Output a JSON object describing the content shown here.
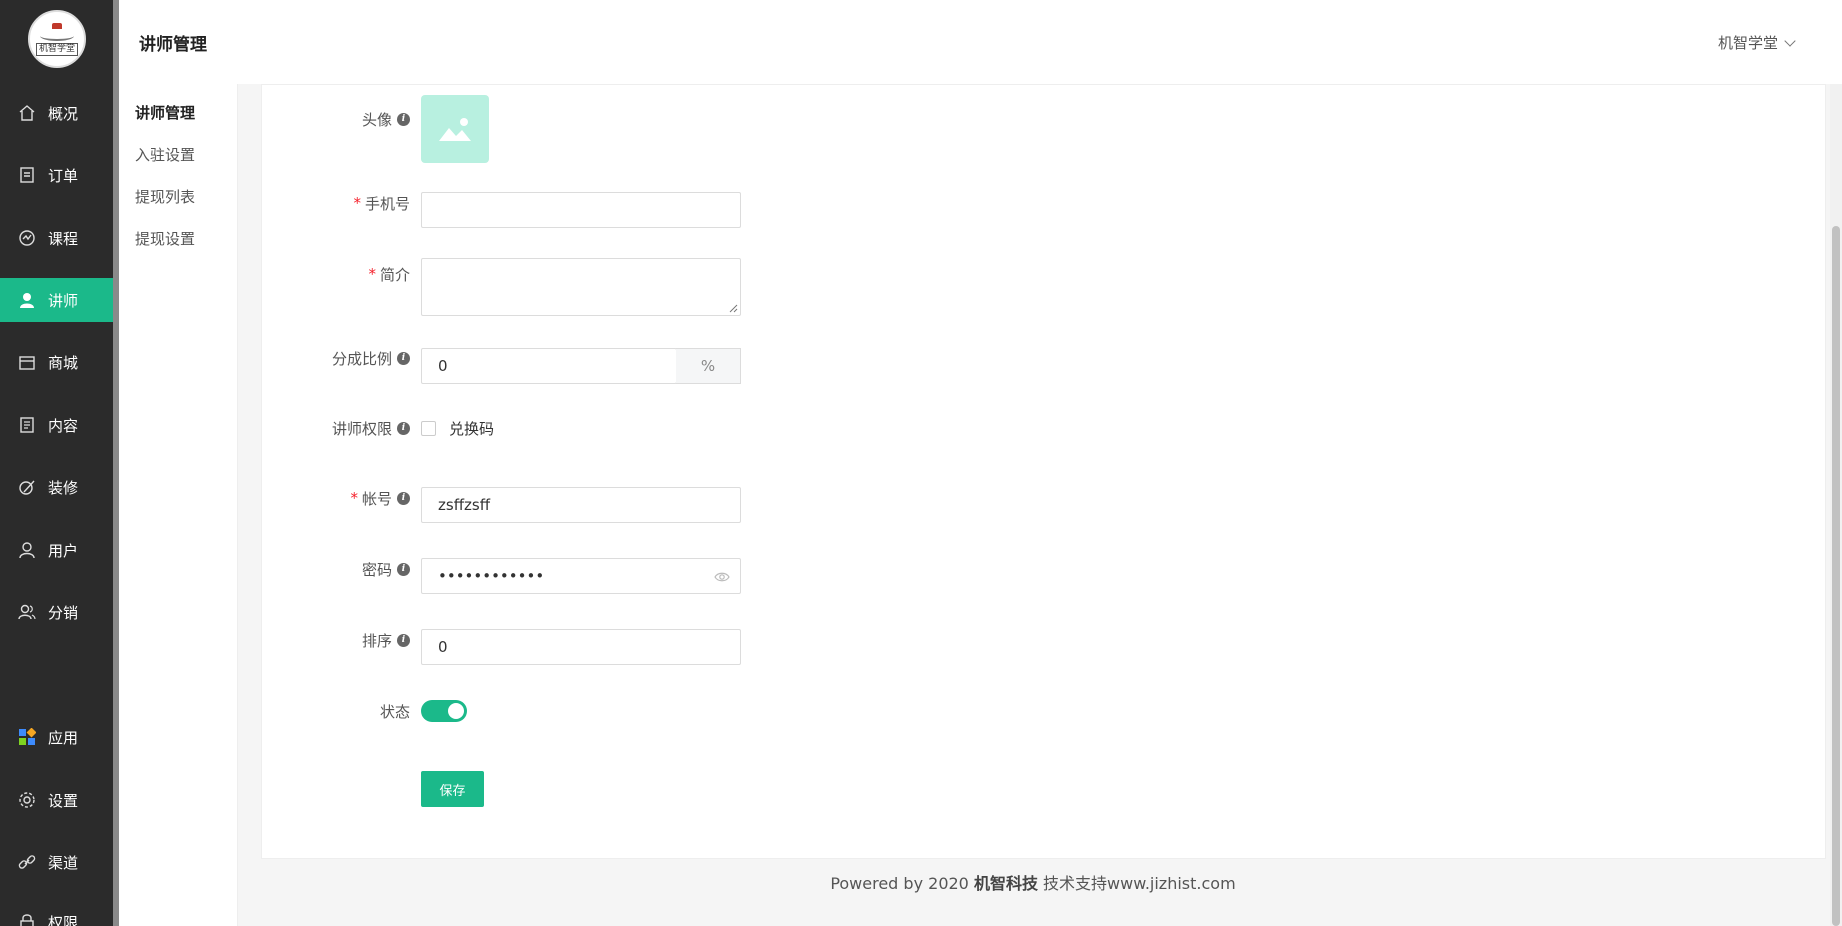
{
  "logo": {
    "text": "机智学堂"
  },
  "nav": {
    "items": [
      {
        "label": "概况",
        "icon": "home-icon"
      },
      {
        "label": "订单",
        "icon": "order-icon"
      },
      {
        "label": "课程",
        "icon": "course-icon"
      },
      {
        "label": "讲师",
        "icon": "teacher-icon",
        "active": true
      },
      {
        "label": "商城",
        "icon": "shop-icon"
      },
      {
        "label": "内容",
        "icon": "content-icon"
      },
      {
        "label": "装修",
        "icon": "decorate-icon"
      },
      {
        "label": "用户",
        "icon": "user-icon"
      },
      {
        "label": "分销",
        "icon": "distribution-icon"
      },
      {
        "label": "应用",
        "icon": "apps-icon"
      },
      {
        "label": "设置",
        "icon": "gear-icon"
      },
      {
        "label": "渠道",
        "icon": "link-icon"
      },
      {
        "label": "权限",
        "icon": "lock-icon"
      }
    ]
  },
  "subnav": {
    "items": [
      {
        "label": "讲师管理",
        "active": true
      },
      {
        "label": "入驻设置"
      },
      {
        "label": "提现列表"
      },
      {
        "label": "提现设置"
      }
    ]
  },
  "header": {
    "title": "讲师管理",
    "user": "机智学堂"
  },
  "form": {
    "avatar_label": "头像",
    "phone_label": "手机号",
    "phone_value": "",
    "intro_label": "简介",
    "intro_value": "",
    "ratio_label": "分成比例",
    "ratio_value": "0",
    "ratio_unit": "%",
    "permission_label": "讲师权限",
    "permission_option": "兑换码",
    "permission_checked": false,
    "account_label": "帐号",
    "account_value": "zsffzsff",
    "password_label": "密码",
    "password_value": "••••••••••••",
    "sort_label": "排序",
    "sort_value": "0",
    "status_label": "状态",
    "status_on": true,
    "save_label": "保存"
  },
  "footer": {
    "prefix": "Powered by 2020 ",
    "brand": "机智科技",
    "suffix": " 技术支持www.jizhist.com"
  },
  "colors": {
    "accent": "#1bb98a",
    "sidebar": "#2b2b2b",
    "required": "#f5222d"
  }
}
